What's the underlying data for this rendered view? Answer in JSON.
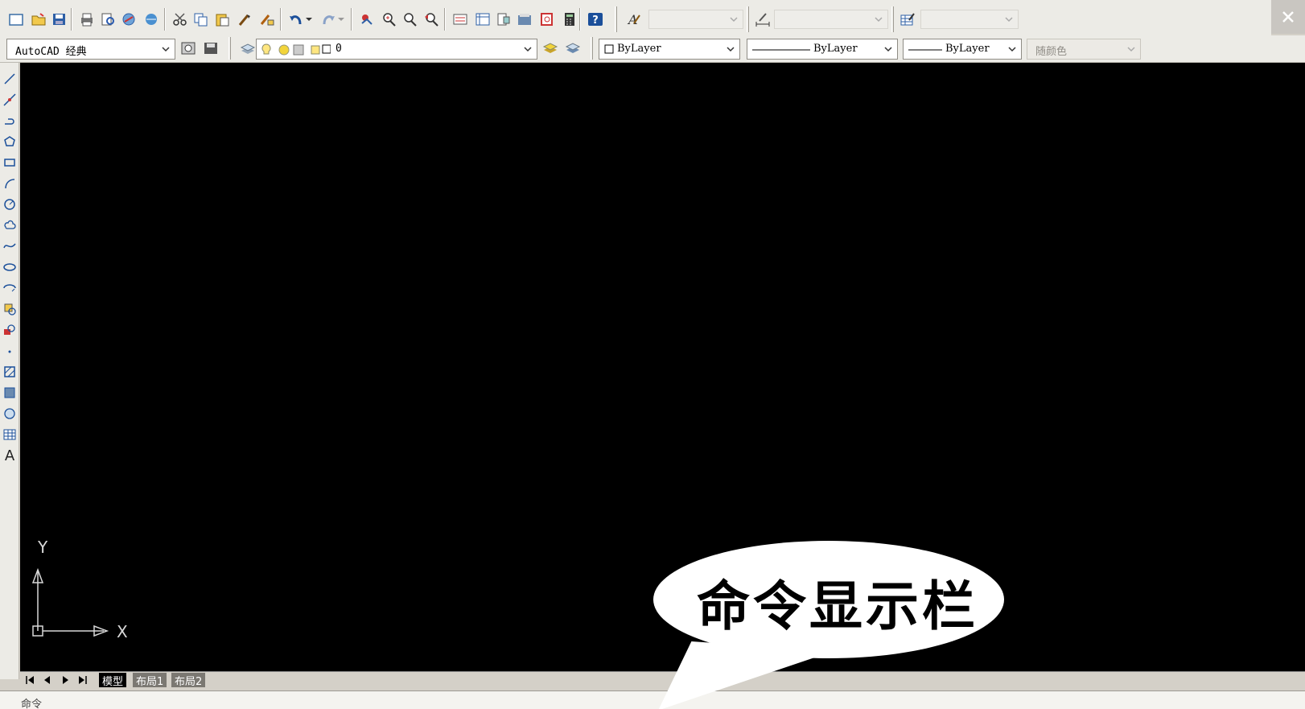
{
  "window": {
    "close_icon": "close-icon"
  },
  "toolbar_standard": {
    "icons": [
      "new-icon",
      "open-icon",
      "save-icon",
      "print-icon",
      "plot-preview-icon",
      "publish-icon",
      "3d-publish-icon",
      "cut-icon",
      "copy-icon",
      "paste-icon",
      "match-properties-icon",
      "block-editor-icon",
      "undo-icon",
      "redo-icon",
      "pan-icon",
      "zoom-realtime-icon",
      "zoom-window-icon",
      "zoom-previous-icon",
      "properties-icon",
      "design-center-icon",
      "tool-palettes-icon",
      "sheet-set-icon",
      "markup-icon",
      "quickcalc-icon",
      "help-icon",
      "text-style-icon",
      "dimension-style-icon",
      "table-style-icon"
    ],
    "text_style_value": "",
    "dim_style_value": "",
    "table_style_value": ""
  },
  "toolbar_workspace": {
    "workspace_value": "AutoCAD 经典",
    "layer_value": "0",
    "color_value": "ByLayer",
    "linetype_value": "ByLayer",
    "lineweight_value": "ByLayer",
    "plotstyle_value": "随颜色"
  },
  "draw_toolbar": {
    "icons": [
      "line-icon",
      "construction-line-icon",
      "polyline-icon",
      "polygon-icon",
      "rectangle-icon",
      "arc-icon",
      "circle-icon",
      "revision-cloud-icon",
      "spline-icon",
      "ellipse-icon",
      "ellipse-arc-icon",
      "insert-block-icon",
      "make-block-icon",
      "point-icon",
      "hatch-icon",
      "gradient-icon",
      "region-icon",
      "table-icon",
      "multiline-text-icon"
    ],
    "text_tool_label": "A"
  },
  "canvas": {
    "ucs_y_label": "Y",
    "ucs_x_label": "X"
  },
  "layout_tabs": {
    "tabs": [
      "模型",
      "布局1",
      "布局2"
    ],
    "active_index": 0
  },
  "command_line": {
    "label": "命令"
  },
  "callout": {
    "text": "命令显示栏"
  },
  "colors": {
    "canvas_bg": "#000000",
    "toolbar_bg": "#ecebe6",
    "bubble_fill": "#ffffff"
  }
}
